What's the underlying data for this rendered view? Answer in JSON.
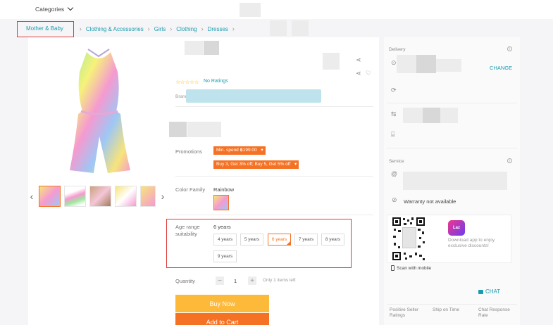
{
  "header": {
    "categories_label": "Categories"
  },
  "breadcrumb": [
    "Mother & Baby",
    "Clothing & Accessories",
    "Girls",
    "Clothing",
    "Dresses"
  ],
  "product": {
    "no_ratings": "No Ratings",
    "brand_label": "Brand",
    "promotions_label": "Promotions",
    "promo_min_spend": "Min. spend ฿199.00",
    "promo_bundle": "Buy 3, Get 3% off; Buy 5, Get 5% off",
    "color_family_label": "Color Family",
    "color_value": "Rainbow",
    "age_label_line1": "Age range",
    "age_label_line2": "suitability",
    "age_selected": "6 years",
    "age_options": [
      "4 years",
      "5 years",
      "6 years",
      "7 years",
      "8 years",
      "9 years"
    ],
    "quantity_label": "Quantity",
    "quantity_value": "1",
    "stock_note": "Only 1 items left",
    "buy_now": "Buy Now",
    "add_to_cart": "Add to Cart"
  },
  "sidebar": {
    "delivery_label": "Delivery",
    "change": "CHANGE",
    "service_label": "Service",
    "warranty": "Warranty not available",
    "app_promo": "Download app to enjoy exclusive discounts!",
    "app_logo": "Laz",
    "scan_label": "Scan with mobile",
    "chat": "CHAT",
    "stat1": "Positive Seller Ratings",
    "stat2": "Ship on Time",
    "stat3": "Chat Response Rate"
  },
  "colors": {
    "accent": "#f57224",
    "link": "#1a9cb0",
    "buy": "#fdb93a",
    "highlight": "#e03a3a"
  }
}
